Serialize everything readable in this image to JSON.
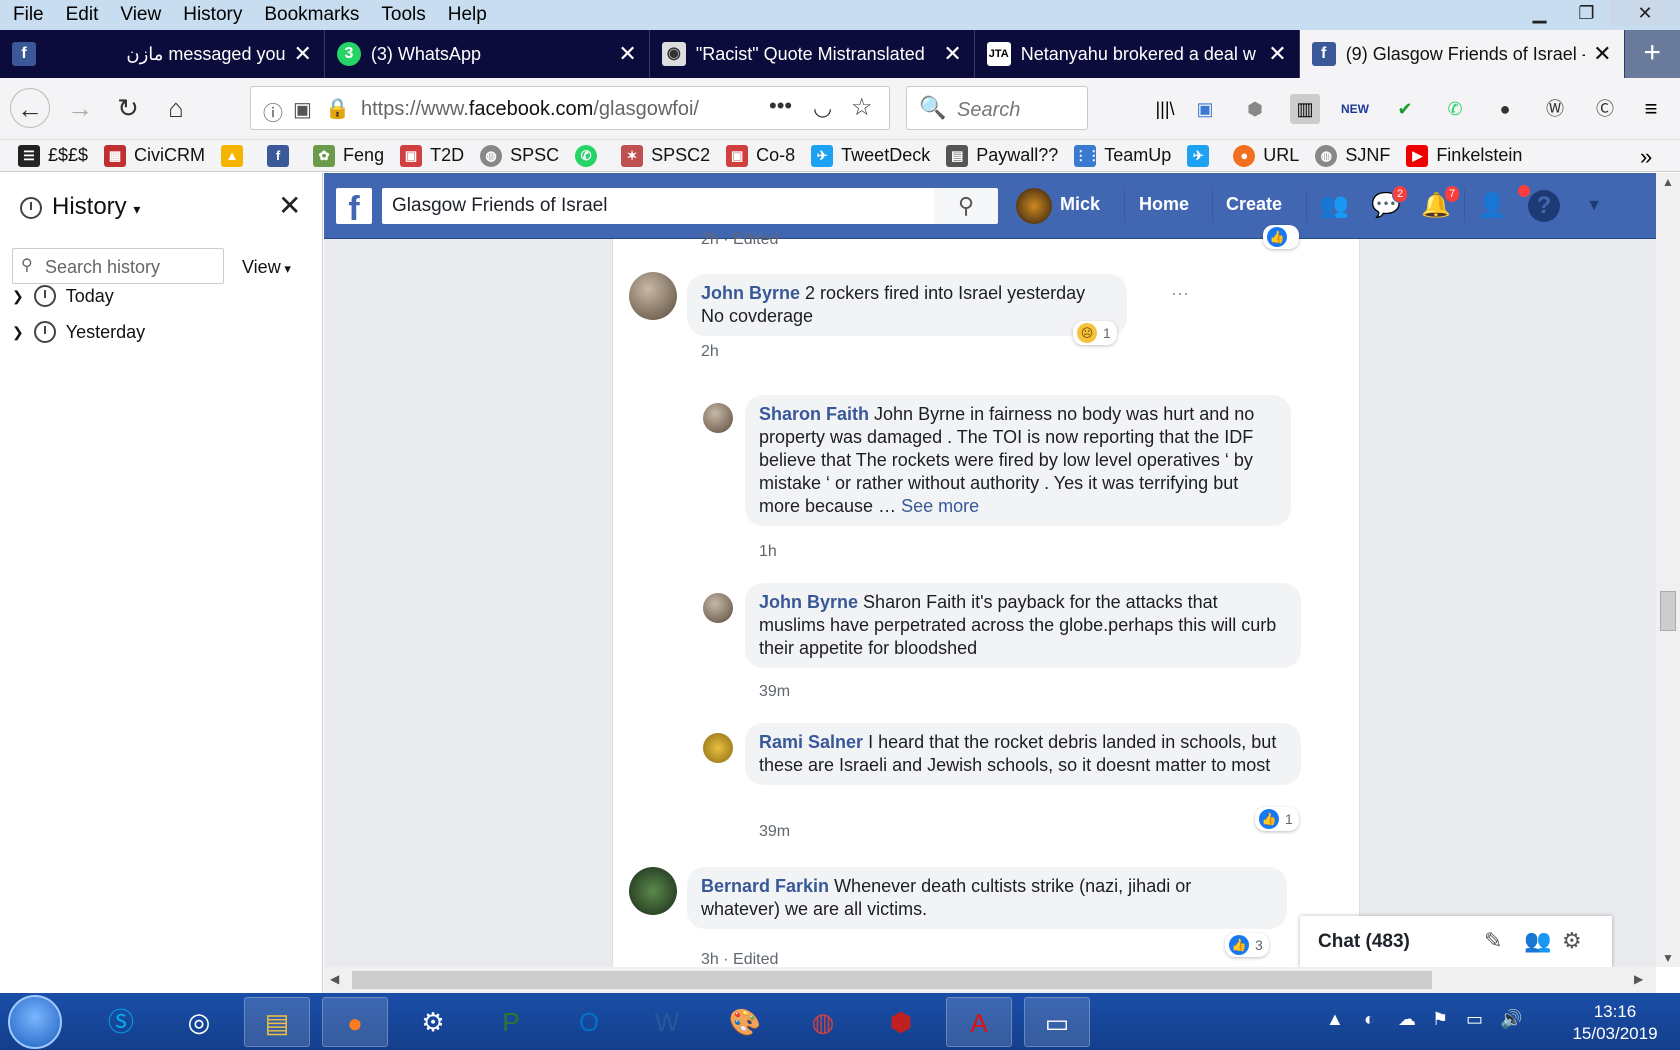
{
  "menubar": {
    "items": [
      "File",
      "Edit",
      "View",
      "History",
      "Bookmarks",
      "Tools",
      "Help"
    ]
  },
  "tabs": [
    {
      "label": "مازن messaged you",
      "icon": "facebook-icon"
    },
    {
      "label": "(3) WhatsApp",
      "icon": "whatsapp-icon"
    },
    {
      "label": "\"Racist\" Quote Mistranslated",
      "icon": "eye-icon"
    },
    {
      "label": "Netanyahu brokered a deal w",
      "icon": "jta-icon"
    },
    {
      "label": "(9) Glasgow Friends of Israel -",
      "icon": "facebook-icon"
    }
  ],
  "nav": {
    "url": "https://www.facebook.com/glasgowfoi/",
    "search_placeholder": "Search"
  },
  "bookmarks": [
    "£$£$",
    "CiviCRM",
    "",
    "",
    "Feng",
    "T2D",
    "SPSC",
    "",
    "SPSC2",
    "Co-8",
    "TweetDeck",
    "Paywall??",
    "TeamUp",
    "",
    "URL",
    "SJNF",
    "Finkelstein"
  ],
  "sidebar": {
    "title": "History",
    "search_placeholder": "Search history",
    "view_label": "View",
    "groups": [
      "Today",
      "Yesterday"
    ]
  },
  "facebook": {
    "search_value": "Glasgow Friends of Israel",
    "user": "Mick",
    "home": "Home",
    "create": "Create",
    "messenger_badge": "2",
    "notifications_badge": "7",
    "top_meta": "2h · Edited",
    "comments": [
      {
        "name": "John Byrne",
        "text": "2 rockers fired into Israel yesterday No covderage",
        "time": "2h",
        "reaction_count": "1"
      },
      {
        "name": "Sharon Faith",
        "text": "John Byrne in fairness no body was hurt and no property was damaged . The TOI is now reporting that the IDF believe that The rockets were fired by low level operatives ‘ by mistake ‘ or rather without authority . Yes it was terrifying but more because …",
        "see_more": "See more",
        "time": "1h"
      },
      {
        "name": "John Byrne",
        "text": "Sharon Faith it's payback for the attacks that muslims have perpetrated across the globe.perhaps this will curb their appetite for bloodshed",
        "time": "39m"
      },
      {
        "name": "Rami Salner",
        "text": "I heard that the rocket debris landed in schools, but these are Israeli and Jewish schools, so it doesnt matter to most",
        "time": "39m",
        "reaction_count": "1"
      },
      {
        "name": "Bernard Farkin",
        "text": "Whenever death cultists strike (nazi, jihadi or whatever) we are all victims.",
        "time": "3h · Edited",
        "reaction_count": "3"
      }
    ],
    "chat_label": "Chat (483)"
  },
  "taskbar": {
    "time": "13:16",
    "date": "15/03/2019"
  }
}
